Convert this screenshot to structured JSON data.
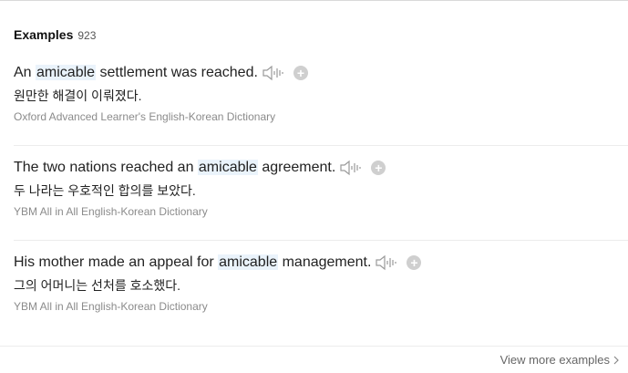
{
  "section": {
    "title": "Examples",
    "count": "923"
  },
  "examples": [
    {
      "before": "An ",
      "highlight": "amicable",
      "after": " settlement was reached.",
      "translation": "원만한 해결이 이뤄졌다.",
      "source": "Oxford Advanced Learner's English-Korean Dictionary"
    },
    {
      "before": "The two nations reached an ",
      "highlight": "amicable",
      "after": " agreement.",
      "translation": "두 나라는 우호적인 합의를 보았다.",
      "source": "YBM All in All English-Korean Dictionary"
    },
    {
      "before": "His mother made an appeal for ",
      "highlight": "amicable",
      "after": " management.",
      "translation": "그의 어머니는 선처를 호소했다.",
      "source": "YBM All in All English-Korean Dictionary"
    }
  ],
  "icons": {
    "speaker": "speaker-icon",
    "add": "plus-circle-icon",
    "chevron": "chevron-right-icon"
  },
  "colors": {
    "highlight_bg": "#eaf3fb",
    "icon_gray": "#cfcfcf",
    "source_gray": "#8b8b8b"
  },
  "footer": {
    "more_label": "View more examples"
  }
}
